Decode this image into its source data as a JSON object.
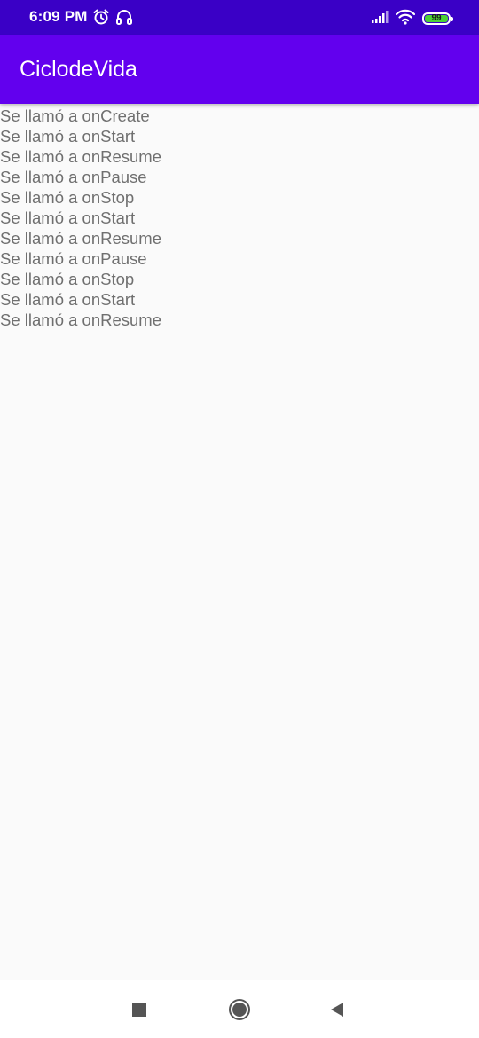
{
  "status_bar": {
    "time": "6:09 PM",
    "battery_level": "99",
    "battery_fraction": 0.99,
    "icons": [
      "alarm-icon",
      "headset-icon",
      "signal-icon",
      "wifi-icon",
      "battery-icon"
    ],
    "background_color": "#3a00c6"
  },
  "app_bar": {
    "title": "CiclodeVida",
    "background_color": "#6200ee"
  },
  "log": [
    "Se llamó a onCreate",
    "Se llamó a onStart",
    "Se llamó a onResume",
    "Se llamó a onPause",
    "Se llamó a onStop",
    "Se llamó a onStart",
    "Se llamó a onResume",
    "Se llamó a onPause",
    "Se llamó a onStop",
    "Se llamó a onStart",
    "Se llamó a onResume"
  ],
  "nav_bar": {
    "buttons": [
      "recents-icon",
      "home-icon",
      "back-icon"
    ]
  }
}
